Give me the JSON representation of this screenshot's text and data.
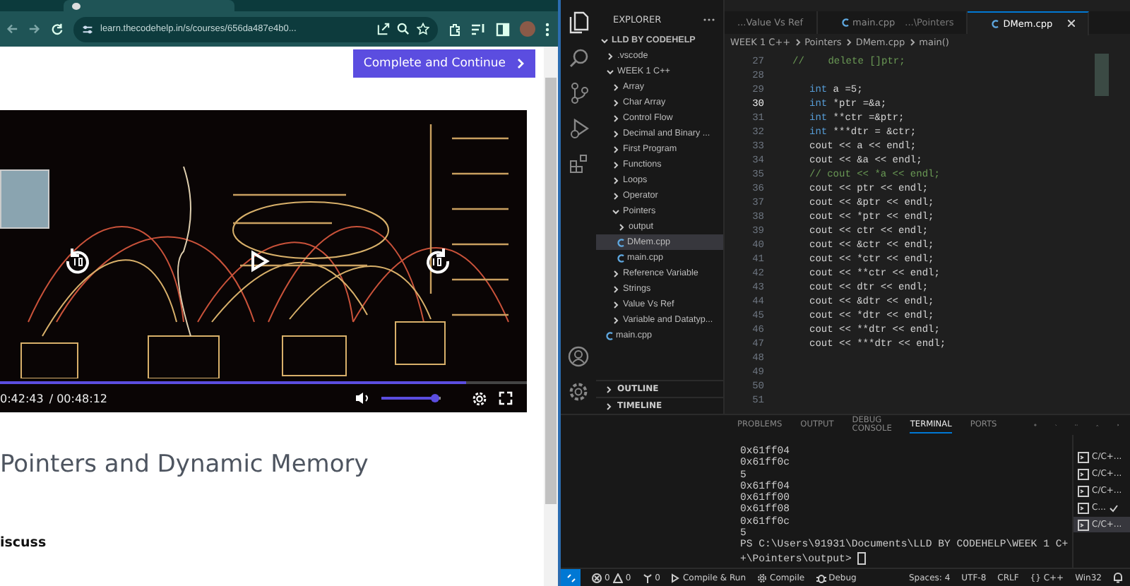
{
  "browser": {
    "url": "learn.thecodehelp.in/s/courses/656da487e4b0...",
    "complete_button": "Complete and Continue",
    "video": {
      "current_time": "0:42:43",
      "duration": "/ 00:48:12",
      "progress": {
        "level": 0.885
      },
      "volume": {
        "level": 0.9
      }
    },
    "lesson_title": "Pointers and Dynamic Memory",
    "section_label": "iscuss"
  },
  "vscode": {
    "explorer": {
      "title": "EXPLORER",
      "tree": [
        {
          "label": "LLD BY CODEHELP",
          "kind": "folder",
          "expanded": true,
          "selected": false,
          "children": [
            {
              "label": ".vscode",
              "kind": "folder",
              "expanded": false,
              "selected": false
            },
            {
              "label": "WEEK 1 C++",
              "kind": "folder",
              "expanded": true,
              "selected": false,
              "children": [
                {
                  "label": "Array",
                  "kind": "folder",
                  "expanded": false,
                  "selected": false
                },
                {
                  "label": "Char Array",
                  "kind": "folder",
                  "expanded": false,
                  "selected": false
                },
                {
                  "label": "Control Flow",
                  "kind": "folder",
                  "expanded": false,
                  "selected": false
                },
                {
                  "label": "Decimal and Binary ...",
                  "kind": "folder",
                  "expanded": false,
                  "selected": false
                },
                {
                  "label": "First Program",
                  "kind": "folder",
                  "expanded": false,
                  "selected": false
                },
                {
                  "label": "Functions",
                  "kind": "folder",
                  "expanded": false,
                  "selected": false
                },
                {
                  "label": "Loops",
                  "kind": "folder",
                  "expanded": false,
                  "selected": false
                },
                {
                  "label": "Operator",
                  "kind": "folder",
                  "expanded": false,
                  "selected": false
                },
                {
                  "label": "Pointers",
                  "kind": "folder",
                  "expanded": true,
                  "selected": false,
                  "children": [
                    {
                      "label": "output",
                      "kind": "folder",
                      "expanded": false,
                      "selected": false
                    },
                    {
                      "label": "DMem.cpp",
                      "kind": "file",
                      "selected": true
                    },
                    {
                      "label": "main.cpp",
                      "kind": "file",
                      "selected": false
                    }
                  ]
                },
                {
                  "label": "Reference Variable",
                  "kind": "folder",
                  "expanded": false,
                  "selected": false
                },
                {
                  "label": "Strings",
                  "kind": "folder",
                  "expanded": false,
                  "selected": false
                },
                {
                  "label": "Value Vs Ref",
                  "kind": "folder",
                  "expanded": false,
                  "selected": false
                },
                {
                  "label": "Variable and Datatyp...",
                  "kind": "folder",
                  "expanded": false,
                  "selected": false
                }
              ]
            },
            {
              "label": "main.cpp",
              "kind": "file",
              "selected": false
            }
          ]
        }
      ],
      "sections": [
        {
          "label": "OUTLINE",
          "expanded": false
        },
        {
          "label": "TIMELINE",
          "expanded": false
        }
      ]
    },
    "tabs": [
      {
        "label": "...Value Vs Ref",
        "selected": false
      },
      {
        "label": "main.cpp",
        "path": "...\\Pointers",
        "selected": false
      },
      {
        "label": "DMem.cpp",
        "selected": true
      }
    ],
    "breadcrumb": [
      "WEEK 1 C++",
      "Pointers",
      "DMem.cpp",
      "main()"
    ],
    "code": [
      {
        "n": "27",
        "kind": "comment",
        "current": false,
        "text": "//    delete []ptr;"
      },
      {
        "n": "28",
        "kind": "blank",
        "current": false
      },
      {
        "n": "29",
        "kind": "decl",
        "current": false,
        "text": "int a =5;"
      },
      {
        "n": "30",
        "kind": "decl",
        "current": true,
        "text": "int *ptr =&a;"
      },
      {
        "n": "31",
        "kind": "decl",
        "current": false,
        "text": "int **ctr =&ptr;"
      },
      {
        "n": "32",
        "kind": "decl",
        "current": false,
        "text": "int ***dtr = &ctr;"
      },
      {
        "n": "33",
        "kind": "stmt",
        "current": false,
        "text": "cout << a << endl;"
      },
      {
        "n": "34",
        "kind": "stmt",
        "current": false,
        "text": "cout << &a << endl;"
      },
      {
        "n": "35",
        "kind": "comment",
        "current": false,
        "text": "// cout << *a << endl;"
      },
      {
        "n": "36",
        "kind": "stmt",
        "current": false,
        "text": "cout << ptr << endl;"
      },
      {
        "n": "37",
        "kind": "stmt",
        "current": false,
        "text": "cout << &ptr << endl;"
      },
      {
        "n": "38",
        "kind": "stmt",
        "current": false,
        "text": "cout << *ptr << endl;"
      },
      {
        "n": "39",
        "kind": "stmt",
        "current": false,
        "text": "cout << ctr << endl;"
      },
      {
        "n": "40",
        "kind": "stmt",
        "current": false,
        "text": "cout << &ctr << endl;"
      },
      {
        "n": "41",
        "kind": "stmt",
        "current": false,
        "text": "cout << *ctr << endl;"
      },
      {
        "n": "42",
        "kind": "stmt",
        "current": false,
        "text": "cout << **ctr << endl;"
      },
      {
        "n": "43",
        "kind": "stmt",
        "current": false,
        "text": "cout << dtr << endl;"
      },
      {
        "n": "44",
        "kind": "stmt",
        "current": false,
        "text": "cout << &dtr << endl;"
      },
      {
        "n": "45",
        "kind": "stmt",
        "current": false,
        "text": "cout << *dtr << endl;"
      },
      {
        "n": "46",
        "kind": "stmt",
        "current": false,
        "text": "cout << **dtr << endl;"
      },
      {
        "n": "47",
        "kind": "stmt",
        "current": false,
        "text": "cout << ***dtr << endl;"
      },
      {
        "n": "48",
        "kind": "blank",
        "current": false
      },
      {
        "n": "49",
        "kind": "blank",
        "current": false
      },
      {
        "n": "50",
        "kind": "blank",
        "current": false
      },
      {
        "n": "51",
        "kind": "blank",
        "current": false
      }
    ],
    "panel": {
      "tabs": [
        {
          "label": "PROBLEMS",
          "selected": false
        },
        {
          "label": "OUTPUT",
          "selected": false
        },
        {
          "label": "DEBUG CONSOLE",
          "selected": false
        },
        {
          "label": "TERMINAL",
          "selected": true
        },
        {
          "label": "PORTS",
          "selected": false
        }
      ],
      "terminal_lines": [
        "0x61ff04",
        "0x61ff0c",
        "5",
        "0x61ff04",
        "0x61ff00",
        "0x61ff08",
        "0x61ff0c",
        "5",
        "PS C:\\Users\\91931\\Documents\\LLD BY CODEHELP\\WEEK 1 C+",
        "+\\Pointers\\output> "
      ],
      "terminals": [
        {
          "label": "C/C+...",
          "selected": false,
          "checked": false
        },
        {
          "label": "C/C+...",
          "selected": false,
          "checked": false
        },
        {
          "label": "C/C+...",
          "selected": false,
          "checked": false
        },
        {
          "label": "C...",
          "selected": false,
          "checked": true
        },
        {
          "label": "C/C+...",
          "selected": true,
          "checked": false
        }
      ]
    },
    "status_bar": {
      "errors": "0",
      "warnings": "0",
      "ports": "0",
      "left": [
        "Compile & Run",
        "Compile",
        "Debug"
      ],
      "right": [
        "Spaces: 4",
        "UTF-8",
        "CRLF",
        "{} C++",
        "Win32"
      ]
    }
  }
}
